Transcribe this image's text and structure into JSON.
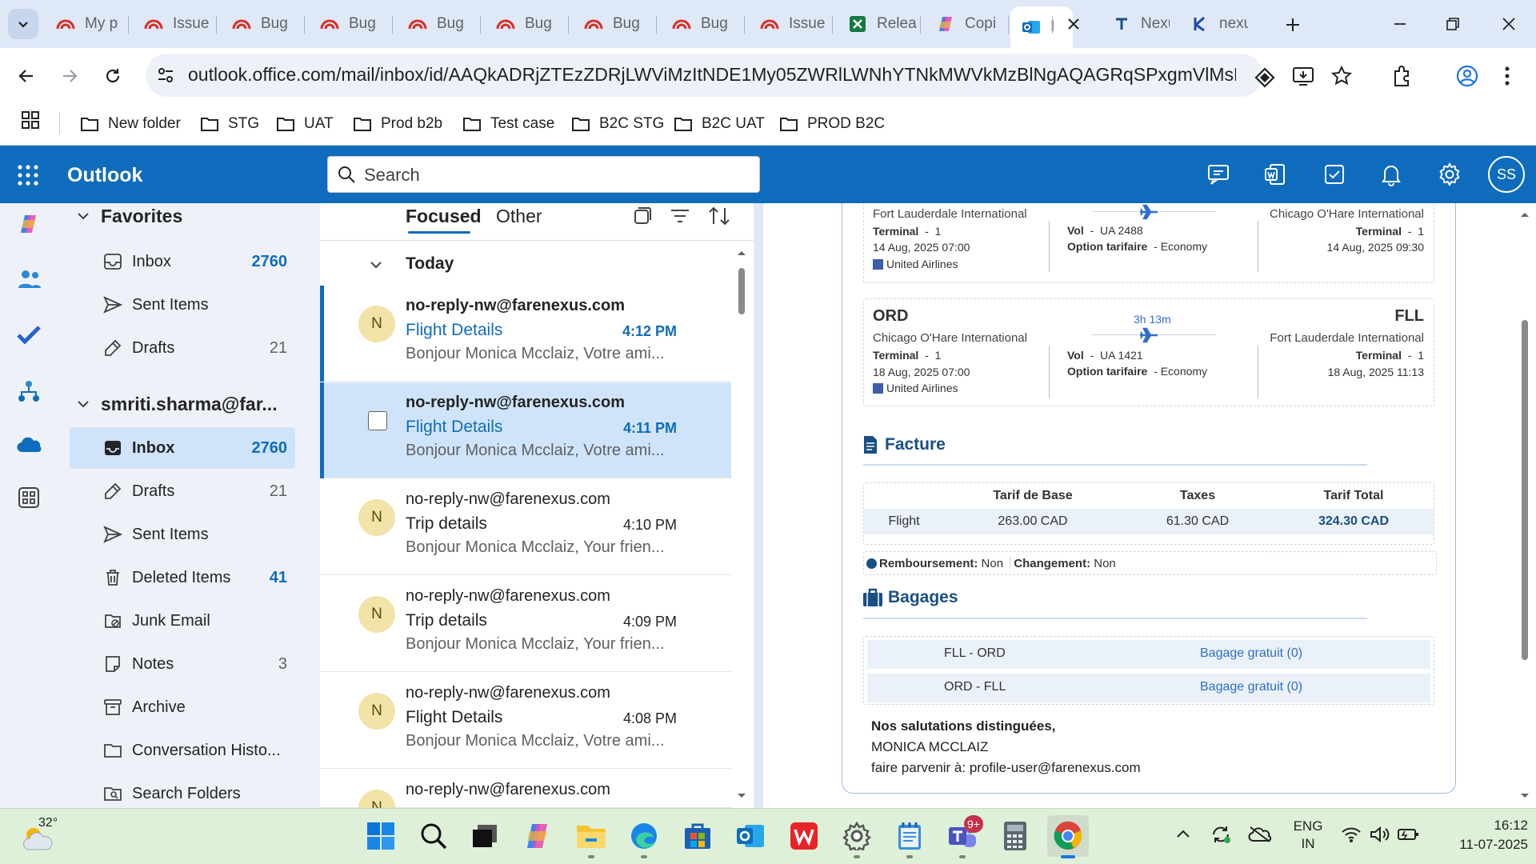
{
  "browser": {
    "tabs": [
      {
        "title": "My p",
        "icon": "redhat-icon"
      },
      {
        "title": "Issue",
        "icon": "redhat-icon"
      },
      {
        "title": "Bug",
        "icon": "redhat-icon"
      },
      {
        "title": "Bug",
        "icon": "redhat-icon"
      },
      {
        "title": "Bug",
        "icon": "redhat-icon"
      },
      {
        "title": "Bug",
        "icon": "redhat-icon"
      },
      {
        "title": "Bug",
        "icon": "redhat-icon"
      },
      {
        "title": "Bug",
        "icon": "redhat-icon"
      },
      {
        "title": "Issue",
        "icon": "redhat-icon"
      },
      {
        "title": "Relea",
        "icon": "excel-icon"
      },
      {
        "title": "Copi",
        "icon": "copilot-icon"
      },
      {
        "title": "I",
        "icon": "outlook-icon",
        "active": true
      },
      {
        "title": "Nexu",
        "icon": "t-icon"
      },
      {
        "title": "nexu",
        "icon": "k-icon"
      }
    ],
    "url": "outlook.office.com/mail/inbox/id/AAQkADRjZTEzZDRjLWViMzItNDE1My05ZWRlLWNhYTNkMWVkMzBlNgAQAGRqSPxgmVlMsBG7AxQMix0...",
    "bookmarks": [
      "New folder",
      "STG",
      "UAT",
      "Prod b2b",
      "Test case",
      "B2C STG",
      "B2C UAT",
      "PROD B2C"
    ]
  },
  "outlook": {
    "app_name": "Outlook",
    "search_placeholder": "Search",
    "avatar_initials": "SS"
  },
  "folders": {
    "favorites_label": "Favorites",
    "favorites": [
      {
        "name": "Inbox",
        "count": "2760",
        "count_style": "blue"
      },
      {
        "name": "Sent Items",
        "count": ""
      },
      {
        "name": "Drafts",
        "count": "21",
        "count_style": "gray"
      }
    ],
    "account_label": "smriti.sharma@far...",
    "account": [
      {
        "name": "Inbox",
        "count": "2760",
        "count_style": "blue",
        "selected": true
      },
      {
        "name": "Drafts",
        "count": "21",
        "count_style": "gray"
      },
      {
        "name": "Sent Items",
        "count": ""
      },
      {
        "name": "Deleted Items",
        "count": "41",
        "count_style": "blue"
      },
      {
        "name": "Junk Email",
        "count": ""
      },
      {
        "name": "Notes",
        "count": "3",
        "count_style": "gray"
      },
      {
        "name": "Archive",
        "count": ""
      },
      {
        "name": "Conversation Histo...",
        "count": ""
      },
      {
        "name": "Search Folders",
        "count": ""
      }
    ]
  },
  "message_list": {
    "tab_focused": "Focused",
    "tab_other": "Other",
    "group_label": "Today",
    "messages": [
      {
        "avatar": "N",
        "from": "no-reply-nw@farenexus.com",
        "subject": "Flight Details",
        "time": "4:12 PM",
        "preview": "Bonjour Monica Mcclaiz, Votre ami...",
        "unread": true
      },
      {
        "avatar": "",
        "from": "no-reply-nw@farenexus.com",
        "subject": "Flight Details",
        "time": "4:11 PM",
        "preview": "Bonjour Monica Mcclaiz, Votre ami...",
        "unread": true,
        "selected": true
      },
      {
        "avatar": "N",
        "from": "no-reply-nw@farenexus.com",
        "subject": "Trip details",
        "time": "4:10 PM",
        "preview": "Bonjour Monica Mcclaiz, Your frien..."
      },
      {
        "avatar": "N",
        "from": "no-reply-nw@farenexus.com",
        "subject": "Trip details",
        "time": "4:09 PM",
        "preview": "Bonjour Monica Mcclaiz, Your frien..."
      },
      {
        "avatar": "N",
        "from": "no-reply-nw@farenexus.com",
        "subject": "Flight Details",
        "time": "4:08 PM",
        "preview": "Bonjour Monica Mcclaiz, Votre ami..."
      },
      {
        "avatar": "N",
        "from": "no-reply-nw@farenexus.com",
        "subject": "",
        "time": "",
        "preview": ""
      }
    ]
  },
  "email": {
    "flight1": {
      "from_airport": "Fort Lauderdale International",
      "terminal_label": "Terminal",
      "from_terminal": "1",
      "dep_time": "14 Aug, 2025 07:00",
      "airline": "United Airlines",
      "vol_label": "Vol",
      "flight_no": "UA 2488",
      "fare_label": "Option tarifaire",
      "fare": "Economy",
      "to_airport": "Chicago O'Hare International",
      "to_terminal": "1",
      "arr_time": "14 Aug, 2025 09:30"
    },
    "flight2": {
      "from_code": "ORD",
      "from_airport": "Chicago O'Hare International",
      "terminal_label": "Terminal",
      "from_terminal": "1",
      "dep_time": "18 Aug, 2025 07:00",
      "airline": "United Airlines",
      "duration": "3h 13m",
      "vol_label": "Vol",
      "flight_no": "UA 1421",
      "fare_label": "Option tarifaire",
      "fare": "Economy",
      "to_code": "FLL",
      "to_airport": "Fort Lauderdale International",
      "to_terminal": "1",
      "arr_time": "18 Aug, 2025 11:13"
    },
    "invoice": {
      "title": "Facture",
      "headers": [
        "",
        "Tarif de Base",
        "Taxes",
        "Tarif Total"
      ],
      "row": [
        "Flight",
        "263.00 CAD",
        "61.30 CAD",
        "324.30 CAD"
      ]
    },
    "policy": {
      "refund_label": "Remboursement:",
      "refund": "Non",
      "change_label": "Changement:",
      "change": "Non"
    },
    "baggage": {
      "title": "Bagages",
      "rows": [
        {
          "route": "FLL - ORD",
          "allowance": "Bagage gratuit (0)"
        },
        {
          "route": "ORD - FLL",
          "allowance": "Bagage gratuit (0)"
        }
      ]
    },
    "closing": "Nos salutations distinguées,",
    "name": "MONICA MCCLAIZ",
    "forward": "faire parvenir à: profile-user@farenexus.com"
  },
  "taskbar": {
    "weather": "32°",
    "teams_badge": "9+",
    "lang1": "ENG",
    "lang2": "IN",
    "time": "16:12",
    "date": "11-07-2025"
  },
  "colors": {
    "outlook_blue": "#0f6cbd",
    "selected_bg": "#cfe4fa",
    "email_heading": "#1a4f86",
    "link_blue": "#2f6fd0"
  }
}
